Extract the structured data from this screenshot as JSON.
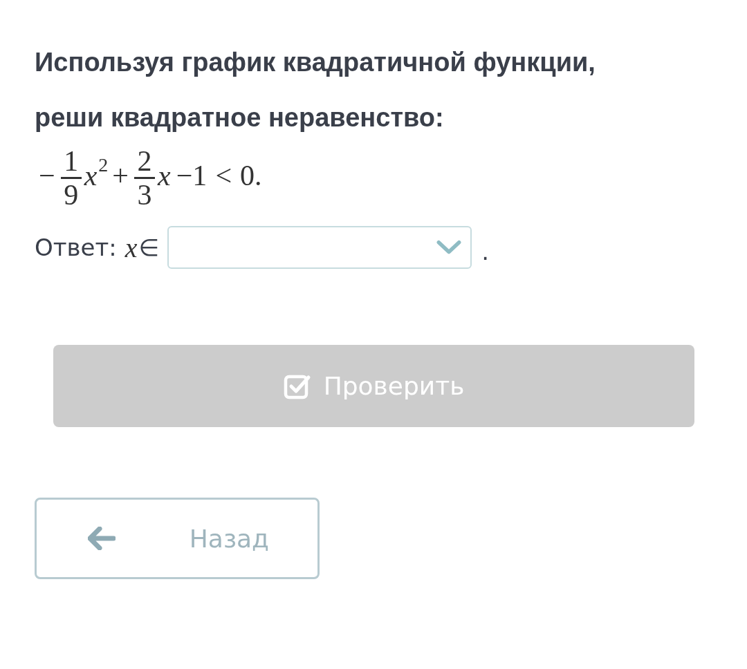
{
  "question": {
    "text": "Используя график квадратичной функции, реши квадратное неравенство:",
    "math": [
      {
        "kind": "op",
        "text": "−"
      },
      {
        "kind": "frac",
        "num": "1",
        "den": "9"
      },
      {
        "kind": "var",
        "text": "x",
        "sup": "2"
      },
      {
        "kind": "op",
        "text": "+"
      },
      {
        "kind": "frac",
        "num": "2",
        "den": "3"
      },
      {
        "kind": "var",
        "text": "x"
      },
      {
        "kind": "op",
        "text": "−1"
      },
      {
        "kind": "op",
        "text": "<"
      },
      {
        "kind": "op",
        "text": "0."
      }
    ]
  },
  "answer": {
    "label": "Ответ:",
    "variable": "x",
    "relation": "∈",
    "end": "."
  },
  "check_button": {
    "label": "Проверить",
    "disabled": true
  },
  "back_button": {
    "label": "Назад"
  }
}
